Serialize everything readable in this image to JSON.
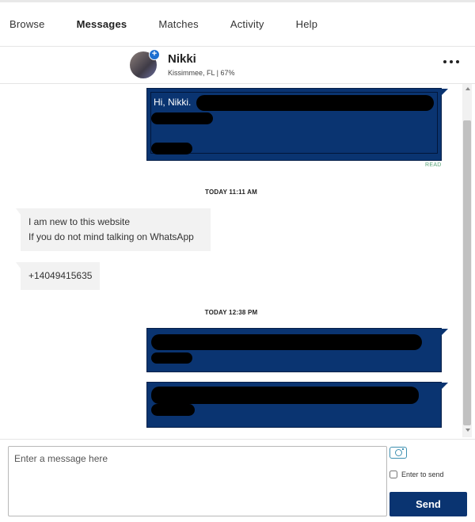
{
  "nav": {
    "items": [
      {
        "label": "Browse"
      },
      {
        "label": "Messages"
      },
      {
        "label": "Matches"
      },
      {
        "label": "Activity"
      },
      {
        "label": "Help"
      }
    ],
    "active": "Messages"
  },
  "chat_header": {
    "name": "Nikki",
    "location": "Kissimmee, FL | 67%",
    "badge": "+"
  },
  "messages": {
    "first_outgoing_text": "Hi, Nikki.",
    "read_label": "READ",
    "time_1": "TODAY 11:11 AM",
    "incoming_1_line1": "I am new to this website",
    "incoming_1_line2": "If you do not mind talking on WhatsApp",
    "incoming_2": "+14049415635",
    "time_2": "TODAY 12:38 PM"
  },
  "composer": {
    "placeholder": "Enter a message here",
    "enter_to_send_label": "Enter to send",
    "send_label": "Send"
  },
  "colors": {
    "outgoing_bubble": "#0a3471",
    "incoming_bubble": "#f2f2f2",
    "read_label": "#5aa57a",
    "send_button": "#0a3471"
  }
}
